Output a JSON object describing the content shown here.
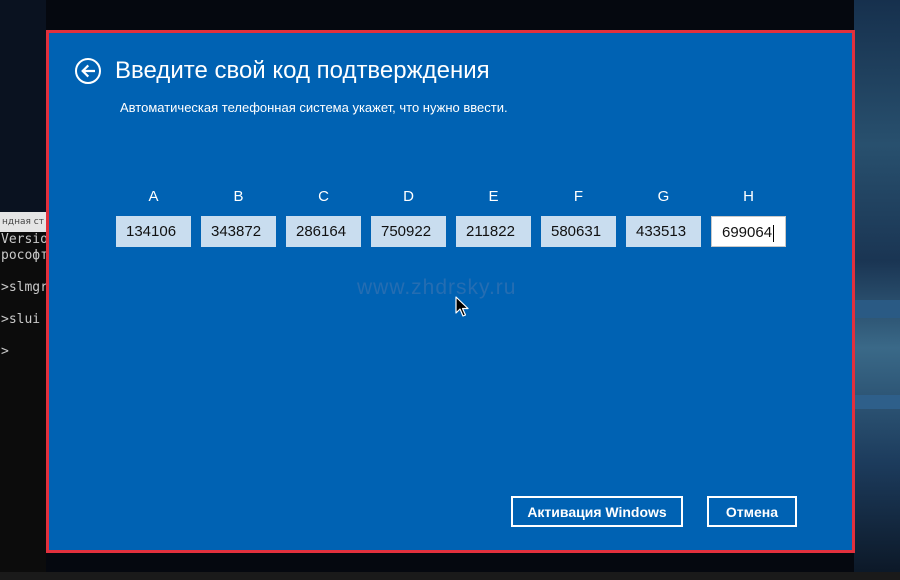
{
  "dialog": {
    "title": "Введите свой код подтверждения",
    "subtitle": "Автоматическая телефонная система укажет, что нужно ввести.",
    "colors": {
      "background": "#0062b3",
      "border": "#e1303d",
      "text": "#ffffff",
      "code_box": "#c9ddef"
    }
  },
  "codes": [
    {
      "letter": "A",
      "value": "134106"
    },
    {
      "letter": "B",
      "value": "343872"
    },
    {
      "letter": "C",
      "value": "286164"
    },
    {
      "letter": "D",
      "value": "750922"
    },
    {
      "letter": "E",
      "value": "211822"
    },
    {
      "letter": "F",
      "value": "580631"
    },
    {
      "letter": "G",
      "value": "433513"
    },
    {
      "letter": "H",
      "value": "699064"
    }
  ],
  "watermark": "www.zhdrsky.ru",
  "buttons": {
    "activate": "Активация Windows",
    "cancel": "Отмена"
  },
  "console": {
    "title": "ндная ст",
    "lines": [
      "Versio",
      "рософт",
      "",
      ">slmgr",
      "",
      ">slui",
      "",
      ">"
    ]
  },
  "icons": {
    "back": "back-arrow-icon",
    "cursor": "mouse-pointer-icon"
  }
}
